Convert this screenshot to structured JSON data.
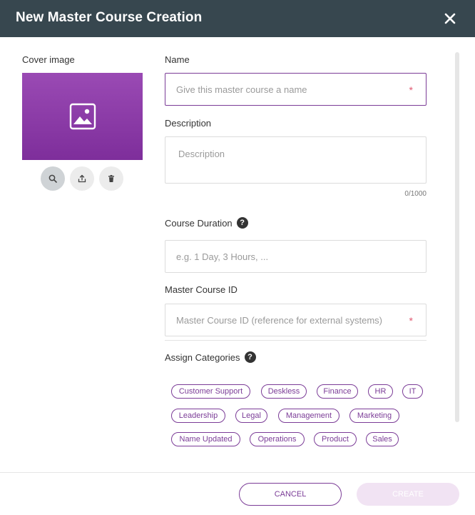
{
  "dialog": {
    "title": "New Master Course Creation"
  },
  "cover": {
    "label": "Cover image"
  },
  "name_field": {
    "label": "Name",
    "placeholder": "Give this master course a name",
    "required_mark": "*"
  },
  "description_field": {
    "label": "Description",
    "placeholder": "Description",
    "counter": "0/1000"
  },
  "duration_field": {
    "label": "Course Duration",
    "help": "?",
    "placeholder": "e.g. 1 Day, 3 Hours, ..."
  },
  "course_id_field": {
    "label": "Master Course ID",
    "placeholder": "Master Course ID (reference for external systems)",
    "required_mark": "*"
  },
  "categories": {
    "label": "Assign Categories",
    "help": "?",
    "items": [
      "Customer Support",
      "Deskless",
      "Finance",
      "HR",
      "IT",
      "Leadership",
      "Legal",
      "Management",
      "Marketing",
      "Name Updated",
      "Operations",
      "Product",
      "Sales"
    ]
  },
  "footer": {
    "cancel_label": "CANCEL",
    "create_label": "CREATE"
  },
  "colors": {
    "header_bg": "#37474f",
    "accent": "#7b3c97",
    "required": "#e05870",
    "create_disabled": "#f1e3f3"
  }
}
